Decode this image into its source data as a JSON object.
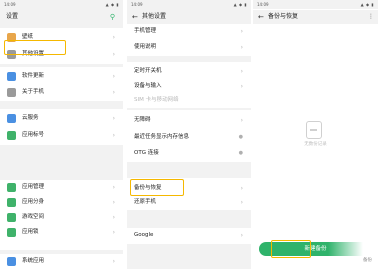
{
  "colors": {
    "accent": "#2fb36b",
    "highlight": "#f5b800"
  },
  "status": {
    "time": "14:09",
    "icons": "▲ ◆ ▮"
  },
  "panel1": {
    "title": "设置",
    "search_icon": "search-icon",
    "items": [
      {
        "label": "壁纸",
        "icon_color": "#e8a64b"
      },
      {
        "label": "其他设置",
        "icon_color": "#9a9a9a"
      },
      {
        "label": "软件更新",
        "icon_color": "#4a90e2"
      },
      {
        "label": "关于手机",
        "icon_color": "#9a9a9a"
      },
      {
        "label": "云服务",
        "icon_color": "#4a90e2"
      },
      {
        "label": "应用标号",
        "icon_color": "#3fb26a"
      },
      {
        "label": "应用管理",
        "icon_color": "#3fb26a"
      },
      {
        "label": "应用分身",
        "icon_color": "#3fb26a"
      },
      {
        "label": "游戏空间",
        "icon_color": "#3fb26a"
      },
      {
        "label": "应用锁",
        "icon_color": "#3fb26a"
      },
      {
        "label": "系统应用",
        "icon_color": "#4a90e2"
      }
    ]
  },
  "panel2": {
    "title": "其他设置",
    "items": [
      {
        "label": "手机管理"
      },
      {
        "label": "使用说明"
      },
      {
        "label": "定时开关机"
      },
      {
        "label": "设备与输入"
      },
      {
        "label": "SIM 卡与移动网络"
      },
      {
        "label": "无障碍"
      },
      {
        "label": "最近任务显示内存信息"
      },
      {
        "label": "OTG 连接"
      },
      {
        "label": "OTG 连接"
      },
      {
        "label": "备份与恢复"
      },
      {
        "label": "还原手机"
      },
      {
        "label": "Google"
      }
    ]
  },
  "panel3": {
    "title": "备份与恢复",
    "empty_text": "无数份记录",
    "button": "新建备份",
    "side_label": "备份"
  }
}
